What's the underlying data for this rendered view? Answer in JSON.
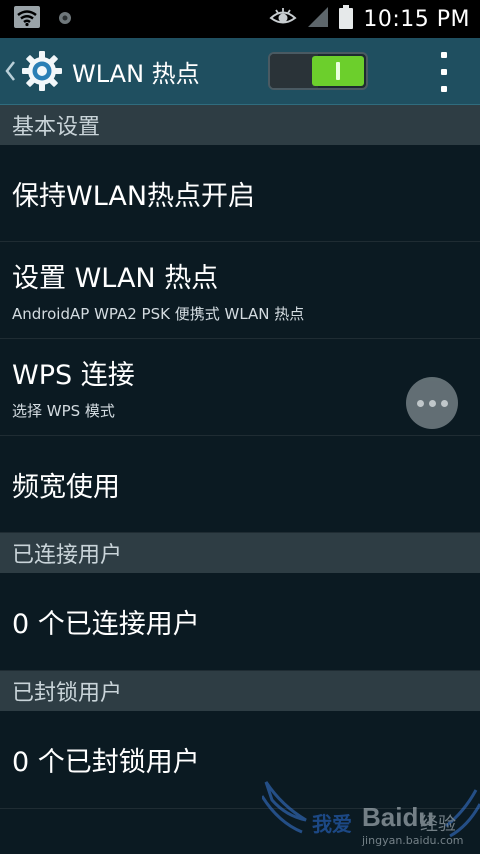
{
  "statusbar": {
    "time": "10:15 PM",
    "icons": [
      "wifi-hotspot-icon",
      "notification-dot-icon",
      "eye-icon",
      "signal-icon",
      "battery-icon"
    ]
  },
  "actionbar": {
    "title": "WLAN 热点",
    "toggle_on": true,
    "accent": "#6ccf2c",
    "background": "#1f4f60"
  },
  "sections": {
    "basic": {
      "header": "基本设置",
      "items": [
        {
          "title": "保持WLAN热点开启"
        },
        {
          "title": "设置 WLAN 热点",
          "subtitle": "AndroidAP WPA2 PSK 便携式 WLAN 热点"
        },
        {
          "title": "WPS 连接",
          "subtitle": "选择 WPS 模式"
        },
        {
          "title": "频宽使用"
        }
      ]
    },
    "connected": {
      "header": "已连接用户",
      "value": "0 个已连接用户"
    },
    "blocked": {
      "header": "已封锁用户",
      "value": "0 个已封锁用户"
    }
  },
  "watermark": {
    "text1": "我爱",
    "brand": "Baidu",
    "text2": "经验",
    "url": "jingyan.baidu.com"
  }
}
